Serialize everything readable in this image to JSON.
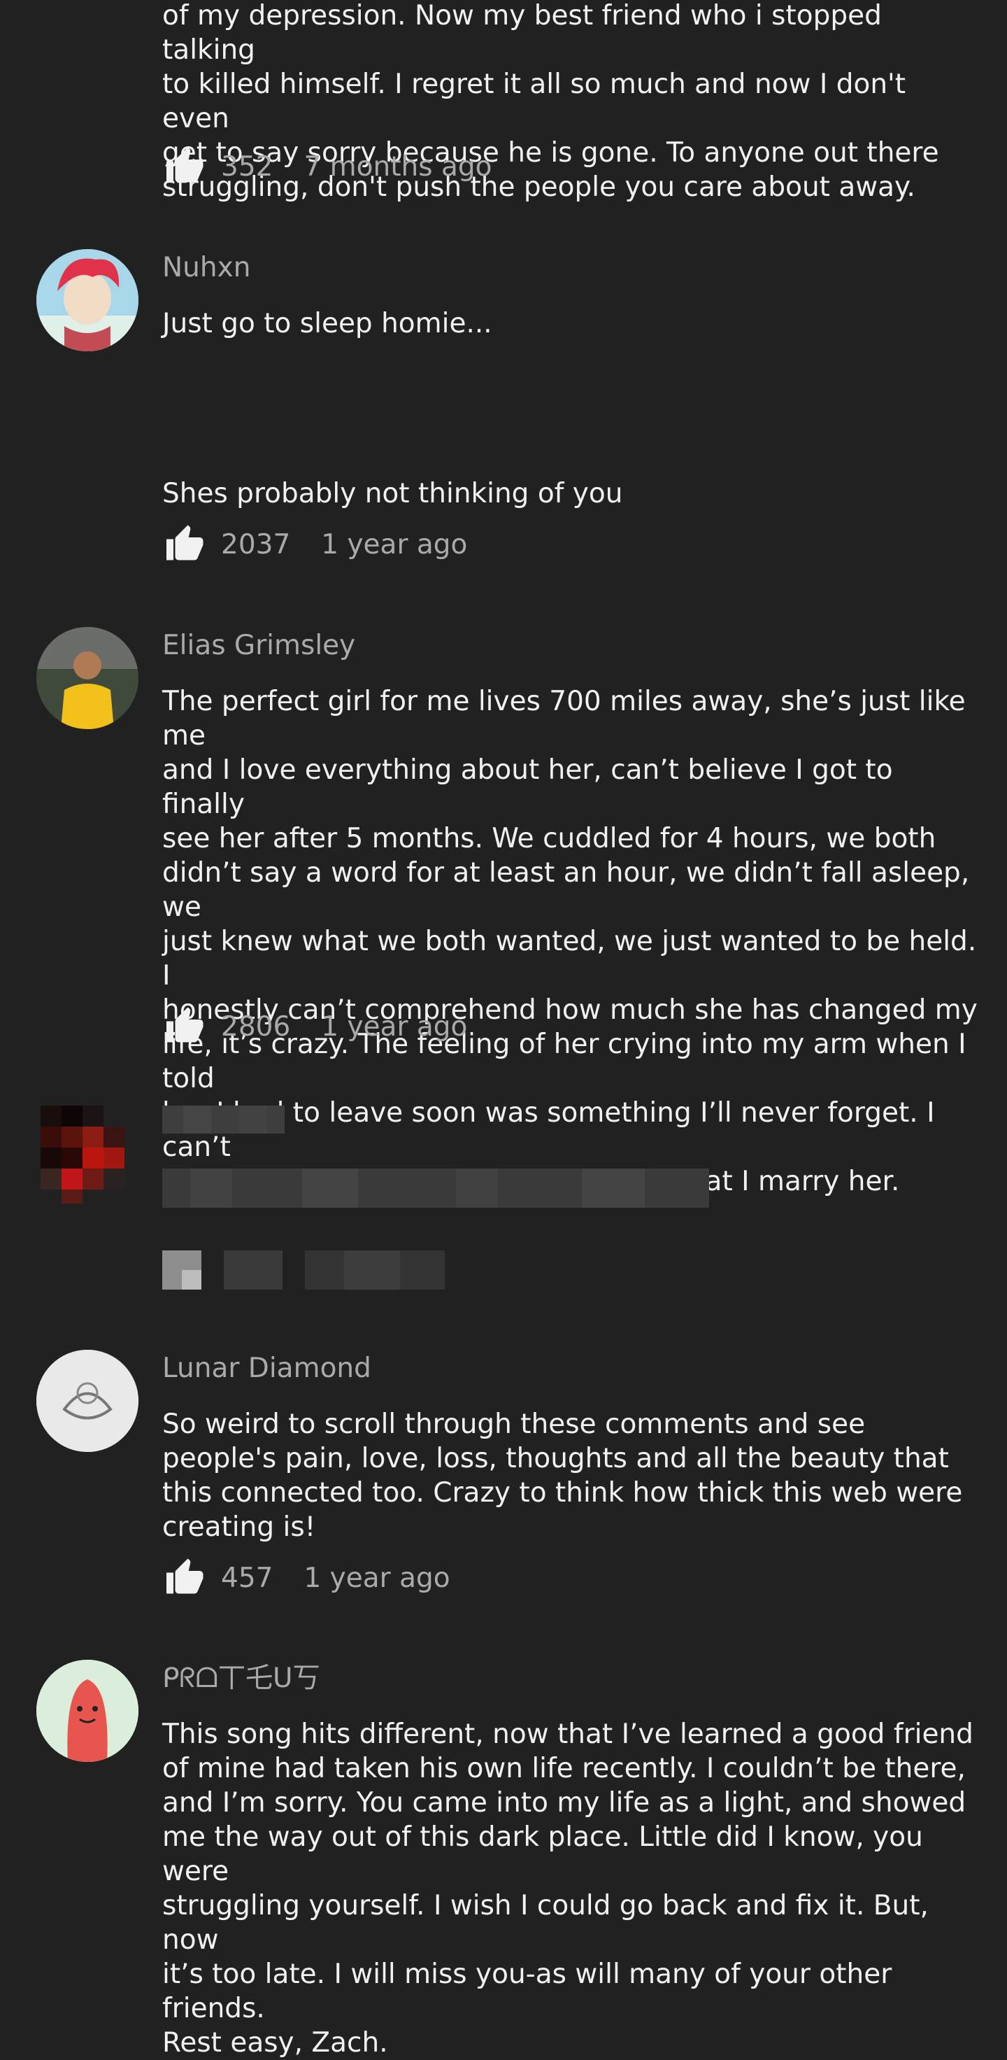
{
  "comments": [
    {
      "author": "",
      "text": "of my depression. Now my best friend who i stopped talking\nto killed himself. I regret it all so much and now I don't even\nget to say sorry because he is gone. To anyone out there\nstruggling, don't push the people you care about away.",
      "likes": "352",
      "time": "7 months ago"
    },
    {
      "author": "Nuhxn",
      "text": "Just go to sleep homie...",
      "text_continued": "Shes probably not thinking of you",
      "likes": "2037",
      "time": "1 year ago"
    },
    {
      "author": "Elias Grimsley",
      "text": "The perfect girl for me lives 700 miles away, she’s just like me\nand I love everything about her, can’t believe I got to finally\nsee her after 5 months. We cuddled for 4 hours, we both\ndidn’t say a word for at least an hour, we didn’t fall asleep, we\njust knew what we both wanted, we just wanted to be held. I\nhonestly can’t comprehend how much she has changed my\nlife, it’s crazy. The feeling of her crying into my arm when I told\nher I had to leave soon was something I’ll never forget. I can’t\nwait to see her again and for the day that I marry her.",
      "likes": "2806",
      "time": "1 year ago"
    },
    {
      "author": "Lunar Diamond",
      "text": "So weird to scroll through these comments and see\npeople's pain, love, loss, thoughts and all the beauty that\nthis connected too. Crazy to think how thick this web were\ncreating is!",
      "likes": "457",
      "time": "1 year ago"
    },
    {
      "author": "ᑭᖇᗝ丅乇ᑌ丂",
      "text": "This song hits different, now that I’ve learned a good friend\nof mine had taken his own life recently. I couldn’t be there,\nand I’m sorry. You came into my life as a light, and showed\nme the way out of this dark place. Little did I know, you were\nstruggling yourself. I wish I could go back and fix it. But, now\nit’s too late. I will miss you-as will many of your other friends.\nRest easy, Zach."
    }
  ],
  "icons": {
    "like": "thumbs-up-icon"
  },
  "colors": {
    "background": "#212121",
    "text": "#f1f1f1",
    "secondary": "#aaaaaa"
  }
}
